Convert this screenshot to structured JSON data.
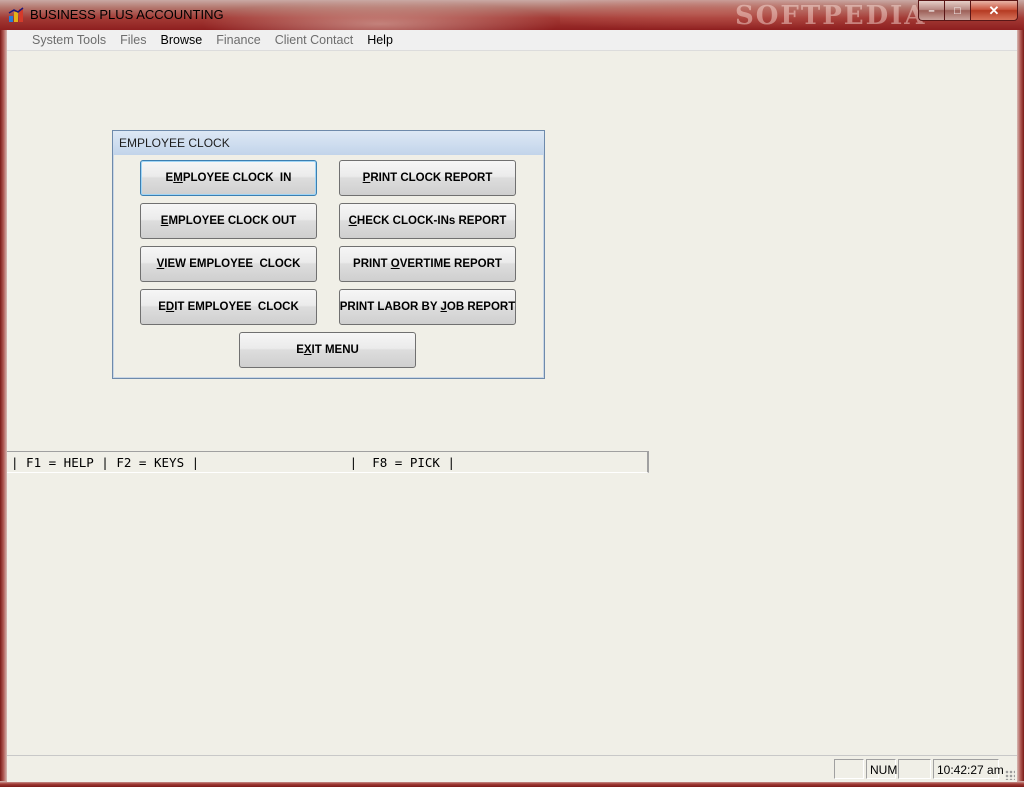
{
  "window": {
    "title": "BUSINESS PLUS ACCOUNTING",
    "watermark": "SOFTPEDIA",
    "minimize_glyph": "–",
    "maximize_glyph": "□",
    "close_glyph": "✕"
  },
  "menu": [
    {
      "label": "System Tools",
      "enabled": false
    },
    {
      "label": "Files",
      "enabled": false
    },
    {
      "label": "Browse",
      "enabled": true
    },
    {
      "label": "Finance",
      "enabled": false
    },
    {
      "label": "Client Contact",
      "enabled": false
    },
    {
      "label": "Help",
      "enabled": true
    }
  ],
  "dialog": {
    "title": "EMPLOYEE CLOCK",
    "buttons": {
      "clock_in": {
        "pre": "E",
        "ul": "M",
        "post": "PLOYEE CLOCK  IN"
      },
      "clock_out": {
        "pre": "",
        "ul": "E",
        "post": "MPLOYEE CLOCK OUT"
      },
      "view": {
        "pre": "",
        "ul": "V",
        "post": "IEW EMPLOYEE  CLOCK"
      },
      "edit": {
        "pre": "E",
        "ul": "D",
        "post": "IT EMPLOYEE  CLOCK"
      },
      "print_clock": {
        "pre": "",
        "ul": "P",
        "post": "RINT CLOCK REPORT"
      },
      "check_clockins": {
        "pre": "",
        "ul": "C",
        "post": "HECK CLOCK-INs REPORT"
      },
      "print_overtime": {
        "pre": "PRINT ",
        "ul": "O",
        "post": "VERTIME REPORT"
      },
      "print_labor": {
        "pre": "PRINT LABOR BY ",
        "ul": "J",
        "post": "OB REPORT"
      },
      "exit": {
        "pre": "E",
        "ul": "X",
        "post": "IT MENU"
      }
    }
  },
  "fkeys": {
    "text": "| F1 = HELP | F2 = KEYS |                    |  F8 = PICK |"
  },
  "status": {
    "cell1": "",
    "num": "NUM",
    "cell3": "",
    "time": "10:42:27 am"
  },
  "colors": {
    "frame": "#8e1f1f",
    "client_bg": "#f0efe7",
    "dialog_title": "#c2d4ea",
    "focus": "#3c7fb1"
  }
}
